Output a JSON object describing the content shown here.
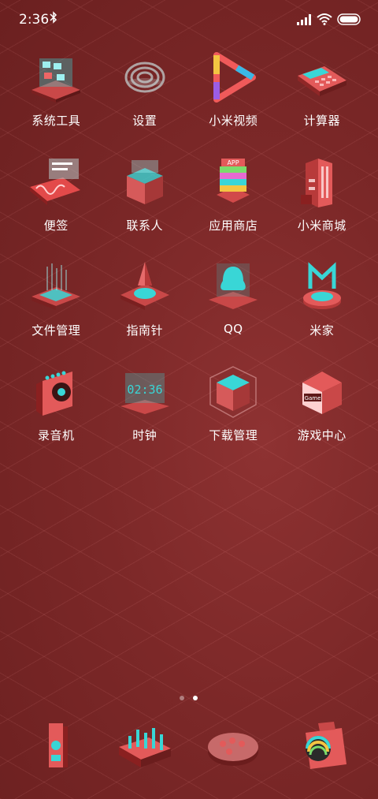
{
  "status_bar": {
    "time": "2:36",
    "bluetooth_icon": "bluetooth-icon",
    "signal_icon": "signal-icon",
    "wifi_icon": "wifi-icon",
    "battery_icon": "battery-icon"
  },
  "apps": [
    {
      "label": "系统工具",
      "icon": "system-tools-icon"
    },
    {
      "label": "设置",
      "icon": "settings-icon"
    },
    {
      "label": "小米视频",
      "icon": "video-play-icon"
    },
    {
      "label": "计算器",
      "icon": "calculator-icon"
    },
    {
      "label": "便签",
      "icon": "notes-icon"
    },
    {
      "label": "联系人",
      "icon": "contacts-icon"
    },
    {
      "label": "应用商店",
      "icon": "app-store-icon"
    },
    {
      "label": "小米商城",
      "icon": "mall-icon"
    },
    {
      "label": "文件管理",
      "icon": "file-manager-icon"
    },
    {
      "label": "指南针",
      "icon": "compass-icon"
    },
    {
      "label": "QQ",
      "icon": "qq-icon"
    },
    {
      "label": "米家",
      "icon": "mijia-icon"
    },
    {
      "label": "录音机",
      "icon": "recorder-icon"
    },
    {
      "label": "时钟",
      "icon": "clock-icon"
    },
    {
      "label": "下载管理",
      "icon": "download-manager-icon"
    },
    {
      "label": "游戏中心",
      "icon": "game-center-icon"
    }
  ],
  "icon_texts": {
    "clock_display": "02:36",
    "app_store_sign": "APP",
    "game_sign": "Game"
  },
  "page_indicator": {
    "count": 2,
    "active": 1
  },
  "dock": [
    {
      "icon": "phone-icon"
    },
    {
      "icon": "messages-icon"
    },
    {
      "icon": "browser-icon"
    },
    {
      "icon": "camera-icon"
    }
  ],
  "colors": {
    "background": "#7c2828",
    "accent_cyan": "#39d6d6",
    "accent_red": "#c94848"
  }
}
